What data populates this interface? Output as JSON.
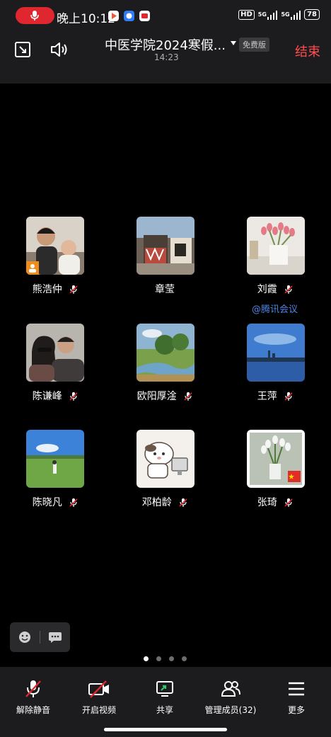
{
  "status_bar": {
    "time": "晚上10:12",
    "network_label": "HD",
    "signal_1": "5G",
    "signal_2": "5G",
    "battery": "78",
    "recording_icon": "microphone-icon",
    "colors": {
      "recording": "#e0262f"
    }
  },
  "header": {
    "meeting_title": "中医学院2024寒假...",
    "plan_badge": "免费版",
    "duration": "14:23",
    "end_button": "结束",
    "icons": [
      "picture-in-picture-icon",
      "speaker-icon",
      "chevron-down-icon"
    ],
    "colors": {
      "end": "#ff4d4f"
    }
  },
  "participants": [
    {
      "name": "熊浩仲",
      "muted": true,
      "avatar": "father-and-child-photo"
    },
    {
      "name": "章莹",
      "muted": false,
      "avatar": "building-street-photo"
    },
    {
      "name": "刘霞",
      "muted": true,
      "avatar": "tulips-vase-photo"
    },
    {
      "name": "陈谦峰",
      "muted": true,
      "avatar": "couple-selfie-photo"
    },
    {
      "name": "欧阳厚淦",
      "muted": true,
      "avatar": "landscape-painting"
    },
    {
      "name": "王萍",
      "muted": true,
      "avatar": "city-skyline-photo"
    },
    {
      "name": "陈晓凡",
      "muted": true,
      "avatar": "grassland-photo"
    },
    {
      "name": "邓柏龄",
      "muted": true,
      "avatar": "cartoon-dog-computer"
    },
    {
      "name": "张琦",
      "muted": true,
      "avatar": "white-flowers-vase-photo"
    }
  ],
  "watermark": "@腾讯会议",
  "pager": {
    "pages": 4,
    "current": 1
  },
  "toolbar": [
    {
      "label": "解除静音",
      "icon": "mic-off-icon"
    },
    {
      "label": "开启视频",
      "icon": "video-off-icon"
    },
    {
      "label": "共享",
      "icon": "share-screen-icon"
    },
    {
      "label": "管理成员(32)",
      "icon": "members-icon"
    },
    {
      "label": "更多",
      "icon": "menu-icon"
    }
  ]
}
